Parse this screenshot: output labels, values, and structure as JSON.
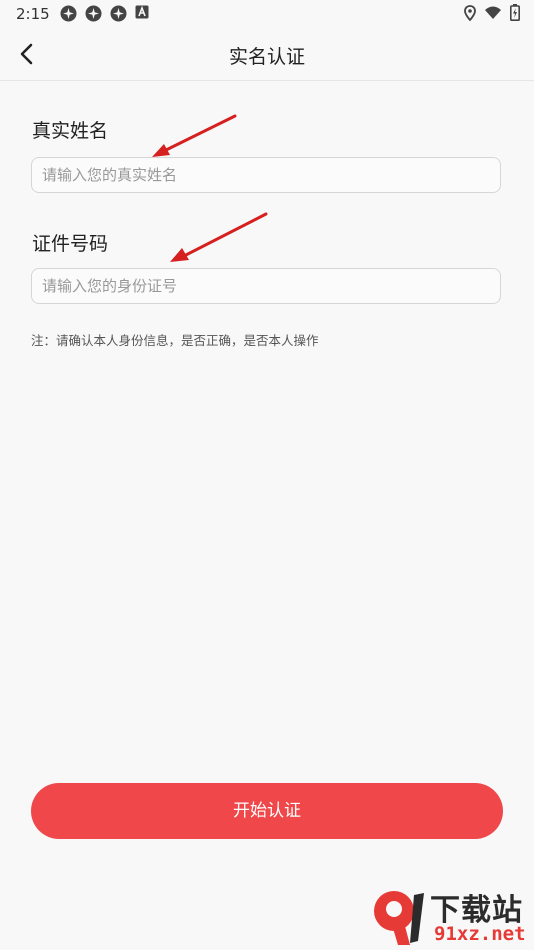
{
  "status_bar": {
    "time": "2:15",
    "left_icons": [
      "notification-icon",
      "notification-icon",
      "notification-icon",
      "keyboard-icon"
    ],
    "right_icons": [
      "location-icon",
      "wifi-icon",
      "battery-icon"
    ]
  },
  "app_bar": {
    "title": "实名认证",
    "back_icon": "chevron-left-icon"
  },
  "form": {
    "name_label": "真实姓名",
    "name_placeholder": "请输入您的真实姓名",
    "name_value": "",
    "id_label": "证件号码",
    "id_placeholder": "请输入您的身份证号",
    "id_value": ""
  },
  "note": "注：请确认本人身份信息，是否正确，是否本人操作",
  "submit_label": "开始认证",
  "watermark": {
    "logo_mark": "9",
    "site_name": "下载站",
    "domain": "91xz.net"
  },
  "colors": {
    "accent": "#f0484a",
    "annotation_arrow": "#d61f1f",
    "background": "#f8f8f8"
  }
}
